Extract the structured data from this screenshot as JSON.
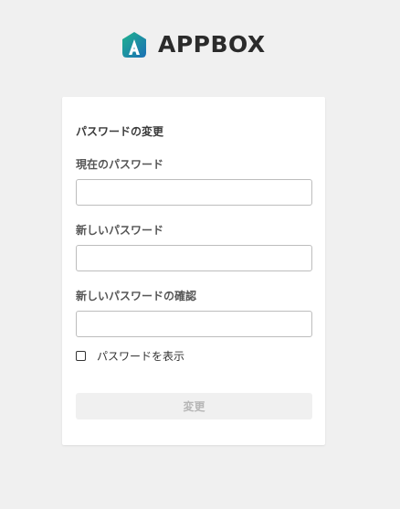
{
  "brand": {
    "name": "APPBOX",
    "logo_colors": [
      "#17a689",
      "#1e73b8",
      "#ffffff"
    ],
    "icon": "appbox-logo-icon"
  },
  "form": {
    "title": "パスワードの変更",
    "current_label": "現在のパスワード",
    "current_value": "",
    "new_label": "新しいパスワード",
    "new_value": "",
    "confirm_label": "新しいパスワードの確認",
    "confirm_value": "",
    "show_password_label": "パスワードを表示",
    "show_password_checked": false,
    "submit_label": "変更",
    "submit_disabled": true
  }
}
